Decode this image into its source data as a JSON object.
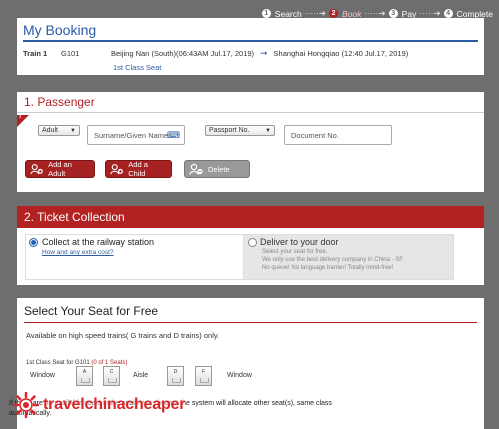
{
  "steps": [
    {
      "num": "1",
      "label": "Search",
      "active": false
    },
    {
      "num": "2",
      "label": "Book",
      "active": true
    },
    {
      "num": "3",
      "label": "Pay",
      "active": false
    },
    {
      "num": "4",
      "label": "Complete",
      "active": false
    }
  ],
  "step_separator": "·····➜",
  "booking": {
    "title": "My Booking",
    "train_label": "Train 1",
    "train_number": "G101",
    "departure": "Beijing Nan (South)(06:43AM Jul.17, 2019)",
    "arrival": "Shanghai Hongqiao (12:40 Jul.17, 2019)",
    "seat_class": "1st Class Seat"
  },
  "passenger": {
    "title": "1. Passenger",
    "flag_mark": "!",
    "type_select": "Adult",
    "name_placeholder": "Surname/Given Names",
    "id_type_select": "Passport No.",
    "document_placeholder": "Document No.",
    "buttons": {
      "add_adult": "Add an Adult",
      "add_child": "Add a Child",
      "delete": "Delete"
    }
  },
  "ticket": {
    "title": "2. Ticket Collection",
    "option1": {
      "title": "Collect at the railway station",
      "link": "How and any extra cost?"
    },
    "option2": {
      "title": "Deliver to your door",
      "desc1": "Select your seat for free.",
      "desc2": "We only use the best delivery company in China - SF.",
      "desc3": "No queue! No language barrier! Totally mind-free!"
    }
  },
  "seats": {
    "title": "Select Your Seat for Free",
    "availability": "Available on high speed trains( G trains and D trains) only.",
    "class_line": "1st Class Seat for G101",
    "count": "(0 of 1 Seats)",
    "window_left": "Window",
    "aisle": "Aisle",
    "window_right": "Window",
    "seat_letters": [
      "A",
      "C",
      "D",
      "F"
    ],
    "notice_line1": "If there are no available seats in the seats you choose, the system will allocate other seat(s), same class",
    "notice_line2": "automatically."
  },
  "watermark": "travelchinacheaper",
  "colors": {
    "accent_red": "#b22222",
    "accent_blue": "#2b5aa6",
    "background": "#6e6e6e"
  },
  "icons": [
    "add-person-icon",
    "add-person-icon",
    "delete-person-icon",
    "keyboard-icon",
    "arrow-right-icon"
  ]
}
